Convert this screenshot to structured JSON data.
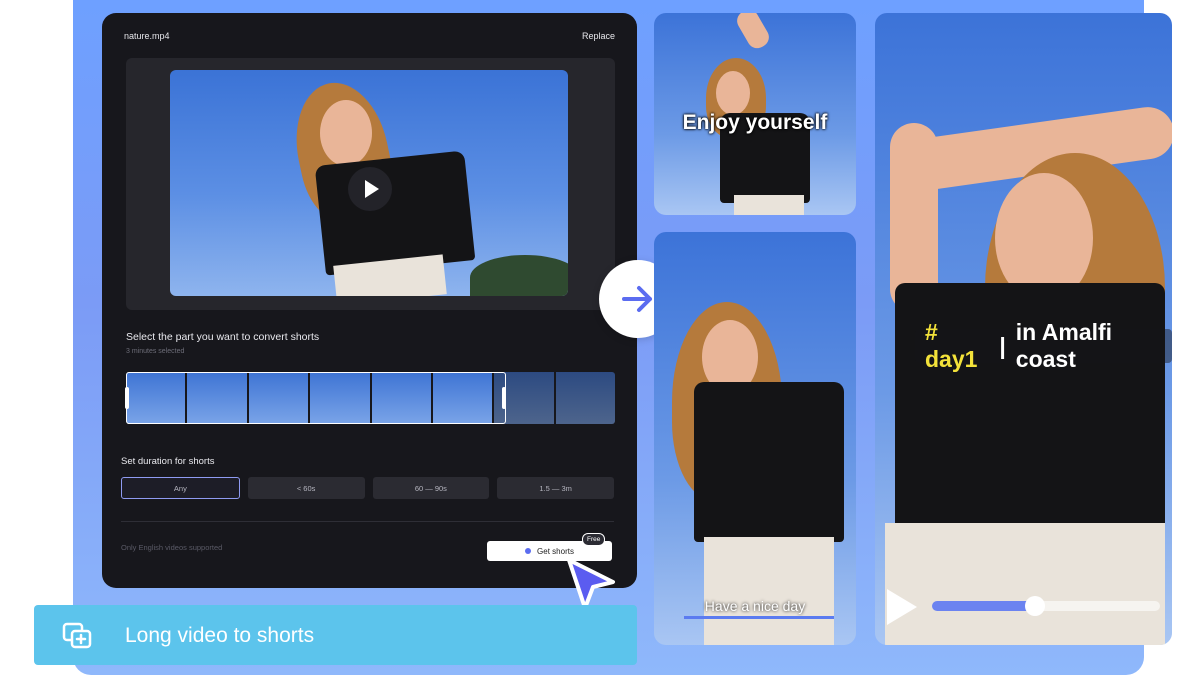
{
  "editor": {
    "file_name": "nature.mp4",
    "replace_label": "Replace",
    "select_title": "Select the part you want to convert shorts",
    "select_subtitle": "3 minutes selected",
    "duration_title": "Set duration for shorts",
    "duration_options": [
      "Any",
      "< 60s",
      "60 — 90s",
      "1.5 — 3m"
    ],
    "duration_selected": "Any",
    "note": "Only English videos supported",
    "get_shorts_label": "Get shorts",
    "free_badge": "Free"
  },
  "shorts": {
    "caption_1": "Enjoy yourself",
    "caption_2": "Have a nice day",
    "tag_hash": "# day1",
    "tag_separator": "|",
    "tag_text": "in Amalfi coast",
    "playback_progress": 0.45
  },
  "feature": {
    "label": "Long video to shorts",
    "icon": "add-clips-icon"
  },
  "colors": {
    "accent": "#5b6cf0",
    "panel_bg": "#17171c",
    "feature_bar": "#5cc4ec",
    "tag_highlight": "#f3e23a"
  }
}
